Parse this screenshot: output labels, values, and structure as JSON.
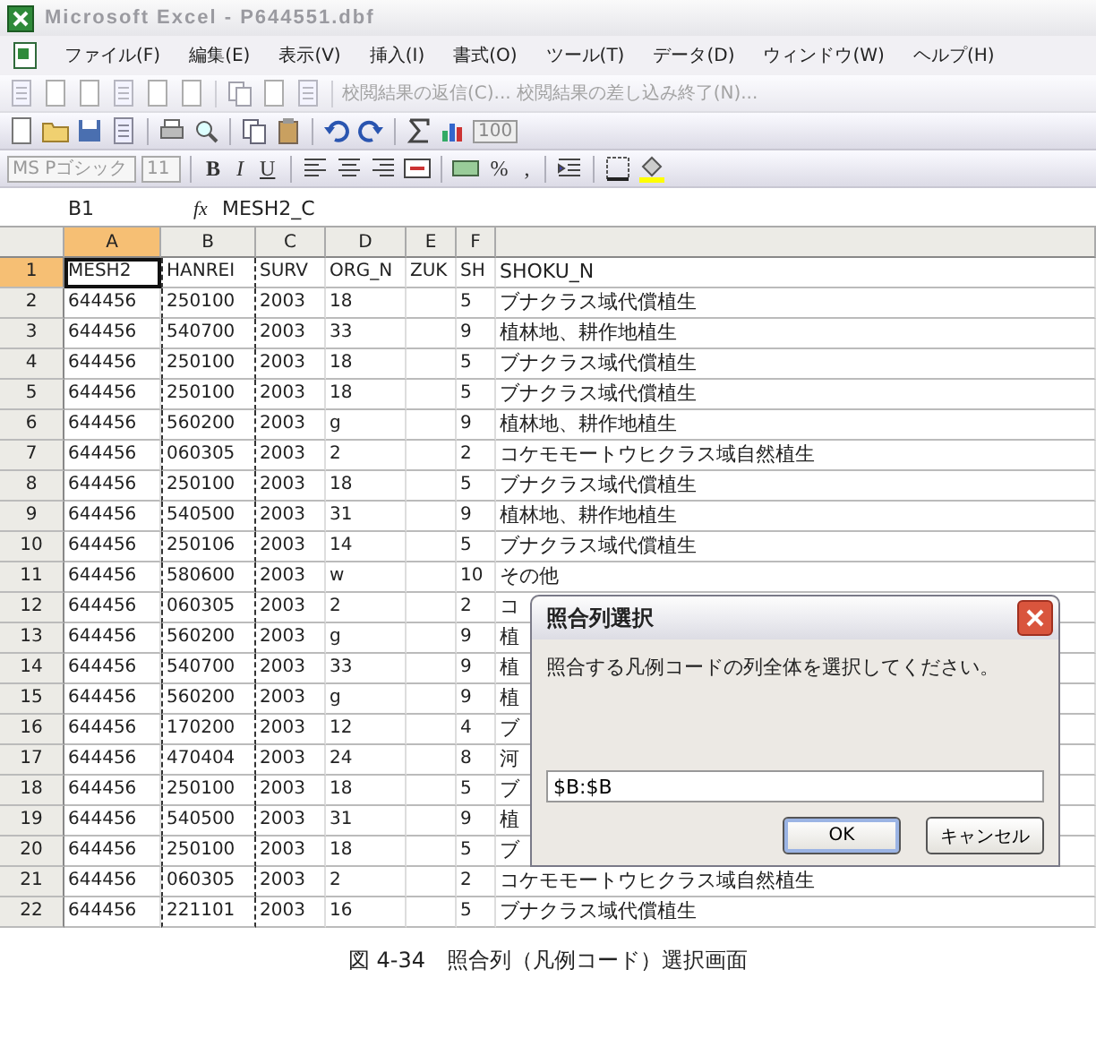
{
  "window": {
    "title": "Microsoft Excel - P644551.dbf"
  },
  "menu": [
    "ファイル(F)",
    "編集(E)",
    "表示(V)",
    "挿入(I)",
    "書式(O)",
    "ツール(T)",
    "データ(D)",
    "ウィンドウ(W)",
    "ヘルプ(H)"
  ],
  "reviewing_toolbar": {
    "buttons": [
      "校閲結果の返信(C)...",
      "校閲結果の差し込み終了(N)..."
    ]
  },
  "standard_toolbar": {
    "zoom": "100"
  },
  "formatting_toolbar": {
    "font": "MS Pゴシック",
    "size": "11",
    "style_buttons": [
      "B",
      "I",
      "U"
    ],
    "number_buttons": [
      "%",
      ","
    ]
  },
  "formula_bar": {
    "name_box": "B1",
    "function_label": "fx",
    "value": "MESH2_C"
  },
  "sheet": {
    "columns": [
      {
        "label": "A",
        "selected": true,
        "marquee": false
      },
      {
        "label": "B",
        "selected": false,
        "marquee": true
      },
      {
        "label": "C",
        "selected": false,
        "marquee": false
      },
      {
        "label": "D",
        "selected": false,
        "marquee": false
      },
      {
        "label": "E",
        "selected": false,
        "marquee": false
      },
      {
        "label": "F",
        "selected": false,
        "marquee": false
      },
      {
        "selected": false,
        "marquee": false
      }
    ],
    "rows": [
      {
        "number": "1",
        "selected": true,
        "cells": [
          "MESH2",
          "HANREI",
          "SURV",
          "ORG_N",
          "ZUK",
          "SH",
          "SHOKU_N"
        ]
      },
      {
        "number": "2",
        "selected": false,
        "cells": [
          "644456",
          "250100",
          "2003",
          "18",
          "",
          "5",
          "ブナクラス域代償植生"
        ]
      },
      {
        "number": "3",
        "selected": false,
        "cells": [
          "644456",
          "540700",
          "2003",
          "33",
          "",
          "9",
          "植林地、耕作地植生"
        ]
      },
      {
        "number": "4",
        "selected": false,
        "cells": [
          "644456",
          "250100",
          "2003",
          "18",
          "",
          "5",
          "ブナクラス域代償植生"
        ]
      },
      {
        "number": "5",
        "selected": false,
        "cells": [
          "644456",
          "250100",
          "2003",
          "18",
          "",
          "5",
          "ブナクラス域代償植生"
        ]
      },
      {
        "number": "6",
        "selected": false,
        "cells": [
          "644456",
          "560200",
          "2003",
          "g",
          "",
          "9",
          "植林地、耕作地植生"
        ]
      },
      {
        "number": "7",
        "selected": false,
        "cells": [
          "644456",
          "060305",
          "2003",
          "2",
          "",
          "2",
          "コケモモートウヒクラス域自然植生"
        ]
      },
      {
        "number": "8",
        "selected": false,
        "cells": [
          "644456",
          "250100",
          "2003",
          "18",
          "",
          "5",
          "ブナクラス域代償植生"
        ]
      },
      {
        "number": "9",
        "selected": false,
        "cells": [
          "644456",
          "540500",
          "2003",
          "31",
          "",
          "9",
          "植林地、耕作地植生"
        ]
      },
      {
        "number": "10",
        "selected": false,
        "cells": [
          "644456",
          "250106",
          "2003",
          "14",
          "",
          "5",
          "ブナクラス域代償植生"
        ]
      },
      {
        "number": "11",
        "selected": false,
        "cells": [
          "644456",
          "580600",
          "2003",
          "w",
          "",
          "10",
          "その他"
        ]
      },
      {
        "number": "12",
        "selected": false,
        "cells": [
          "644456",
          "060305",
          "2003",
          "2",
          "",
          "2",
          "コ"
        ]
      },
      {
        "number": "13",
        "selected": false,
        "cells": [
          "644456",
          "560200",
          "2003",
          "g",
          "",
          "9",
          "植"
        ]
      },
      {
        "number": "14",
        "selected": false,
        "cells": [
          "644456",
          "540700",
          "2003",
          "33",
          "",
          "9",
          "植"
        ]
      },
      {
        "number": "15",
        "selected": false,
        "cells": [
          "644456",
          "560200",
          "2003",
          "g",
          "",
          "9",
          "植"
        ]
      },
      {
        "number": "16",
        "selected": false,
        "cells": [
          "644456",
          "170200",
          "2003",
          "12",
          "",
          "4",
          "ブ"
        ]
      },
      {
        "number": "17",
        "selected": false,
        "cells": [
          "644456",
          "470404",
          "2003",
          "24",
          "",
          "8",
          "河"
        ]
      },
      {
        "number": "18",
        "selected": false,
        "cells": [
          "644456",
          "250100",
          "2003",
          "18",
          "",
          "5",
          "ブ"
        ]
      },
      {
        "number": "19",
        "selected": false,
        "cells": [
          "644456",
          "540500",
          "2003",
          "31",
          "",
          "9",
          "植"
        ]
      },
      {
        "number": "20",
        "selected": false,
        "cells": [
          "644456",
          "250100",
          "2003",
          "18",
          "",
          "5",
          "ブ"
        ]
      },
      {
        "number": "21",
        "selected": false,
        "cells": [
          "644456",
          "060305",
          "2003",
          "2",
          "",
          "2",
          "コケモモートウヒクラス域自然植生"
        ]
      },
      {
        "number": "22",
        "selected": false,
        "cells": [
          "644456",
          "221101",
          "2003",
          "16",
          "",
          "5",
          "ブナクラス域代償植生"
        ]
      }
    ]
  },
  "dialog": {
    "title": "照合列選択",
    "message": "照合する凡例コードの列全体を選択してください。",
    "value": "$B:$B",
    "buttons": [
      {
        "label": "OK",
        "default": true
      },
      {
        "label": "キャンセル",
        "default": false
      }
    ]
  },
  "caption": "図 4-34　照合列（凡例コード）選択画面"
}
